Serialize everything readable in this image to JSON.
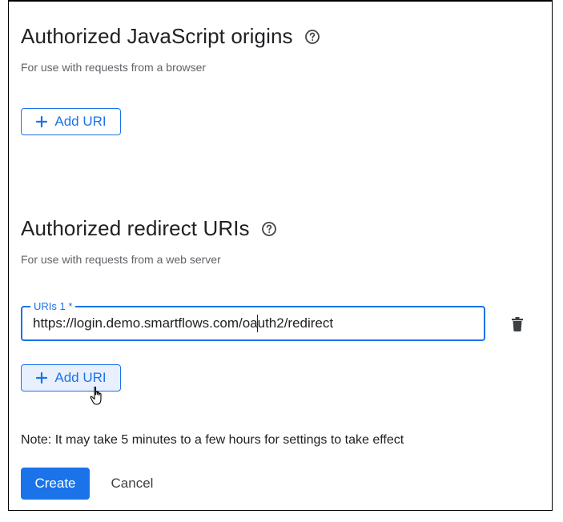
{
  "js_origins": {
    "title": "Authorized JavaScript origins",
    "subtitle": "For use with requests from a browser",
    "add_label": "Add URI"
  },
  "redirect_uris": {
    "title": "Authorized redirect URIs",
    "subtitle": "For use with requests from a web server",
    "field_label": "URIs 1 *",
    "field_value": "https://login.demo.smartflows.com/oauth2/redirect",
    "add_label": "Add URI"
  },
  "note": "Note: It may take 5 minutes to a few hours for settings to take effect",
  "actions": {
    "create_label": "Create",
    "cancel_label": "Cancel"
  },
  "colors": {
    "accent": "#1a73e8",
    "text": "#202124",
    "muted": "#5f6368"
  },
  "icons": [
    "help-circle-icon",
    "plus-icon",
    "trash-icon",
    "hand-pointer-cursor-icon"
  ]
}
